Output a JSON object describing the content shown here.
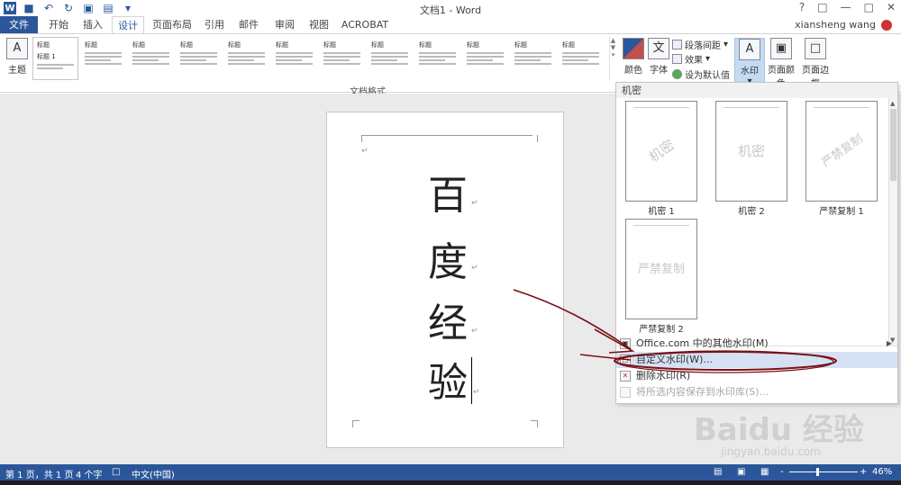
{
  "window": {
    "title": "文档1 - Word",
    "user": "xiansheng wang"
  },
  "tabs": [
    {
      "label": "文件"
    },
    {
      "label": "开始"
    },
    {
      "label": "插入"
    },
    {
      "label": "设计"
    },
    {
      "label": "页面布局"
    },
    {
      "label": "引用"
    },
    {
      "label": "邮件"
    },
    {
      "label": "审阅"
    },
    {
      "label": "视图"
    },
    {
      "label": "ACROBAT"
    }
  ],
  "ribbon": {
    "theme_label": "主题",
    "group_label": "文档格式",
    "styles": [
      {
        "heading": "标题"
      },
      {
        "heading": "标题"
      },
      {
        "heading": "标题"
      },
      {
        "heading": "标题"
      },
      {
        "heading": "标题"
      },
      {
        "heading": "标题"
      },
      {
        "heading": "标题"
      },
      {
        "heading": "标题"
      },
      {
        "heading": "标题"
      },
      {
        "heading": "标题"
      },
      {
        "heading": "标题"
      },
      {
        "heading": "标题"
      }
    ],
    "first_style_sub": "标题 1",
    "colors_label": "颜色",
    "fonts_label": "字体",
    "fonts_glyph": "文",
    "paragraph_spacing": "段落间距",
    "effects": "效果",
    "set_default": "设为默认值",
    "watermark": "水印",
    "page_color": "页面颜色",
    "page_borders": "页面边框"
  },
  "document": {
    "characters": [
      "百",
      "度",
      "经",
      "验"
    ]
  },
  "watermark_menu": {
    "section": "机密",
    "items": [
      {
        "label": "机密 1",
        "text": "机密"
      },
      {
        "label": "机密 2",
        "text": "机密"
      },
      {
        "label": "严禁复制 1",
        "text": "严禁复制"
      },
      {
        "label": "严禁复制 2",
        "text": "严禁复制"
      }
    ],
    "office_more": "Office.com 中的其他水印(M)",
    "custom": "自定义水印(W)...",
    "remove": "删除水印(R)",
    "save": "将所选内容保存到水印库(S)..."
  },
  "status": {
    "page": "第 1 页，共 1 页",
    "words": "4 个字",
    "language": "中文(中国)",
    "zoom": "46%",
    "zoom_minus": "-",
    "zoom_plus": "+"
  },
  "watermark_site": {
    "brand": "Baidu 经验",
    "url": "jingyan.baidu.com"
  }
}
